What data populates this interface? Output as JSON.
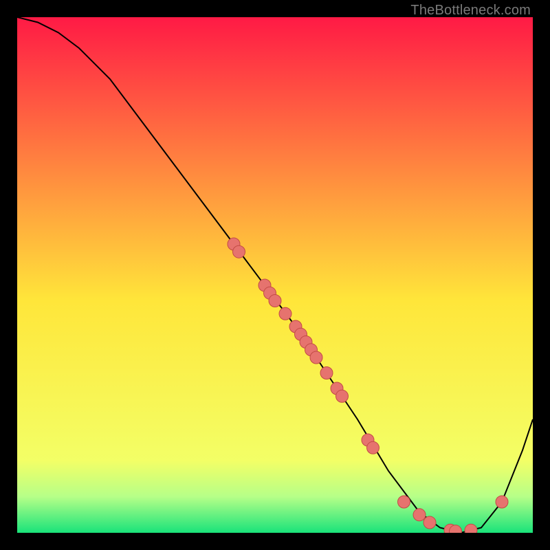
{
  "attribution": "TheBottleneck.com",
  "chart_data": {
    "type": "line",
    "title": "",
    "xlabel": "",
    "ylabel": "",
    "xlim": [
      0,
      100
    ],
    "ylim": [
      0,
      100
    ],
    "background_gradient": {
      "top_color": "#ff1a45",
      "mid_color": "#ffe63a",
      "bottom_color": "#19e37a"
    },
    "series": [
      {
        "name": "bottleneck-curve",
        "x": [
          0,
          4,
          8,
          12,
          18,
          24,
          30,
          36,
          42,
          48,
          54,
          58,
          62,
          66,
          72,
          78,
          82,
          86,
          90,
          94,
          98,
          100
        ],
        "y": [
          100,
          99,
          97,
          94,
          88,
          80,
          72,
          64,
          56,
          48,
          40,
          34,
          28,
          22,
          12,
          4,
          1,
          0,
          1,
          6,
          16,
          22
        ],
        "stroke": "#000000",
        "stroke_width": 2
      }
    ],
    "points": {
      "name": "highlighted-points",
      "fill": "#e6736e",
      "stroke": "#c24b45",
      "radius": 9,
      "coords": [
        {
          "x": 42,
          "y": 56
        },
        {
          "x": 43,
          "y": 54.5
        },
        {
          "x": 48,
          "y": 48
        },
        {
          "x": 49,
          "y": 46.5
        },
        {
          "x": 50,
          "y": 45
        },
        {
          "x": 52,
          "y": 42.5
        },
        {
          "x": 54,
          "y": 40
        },
        {
          "x": 55,
          "y": 38.5
        },
        {
          "x": 56,
          "y": 37
        },
        {
          "x": 57,
          "y": 35.5
        },
        {
          "x": 58,
          "y": 34
        },
        {
          "x": 60,
          "y": 31
        },
        {
          "x": 62,
          "y": 28
        },
        {
          "x": 63,
          "y": 26.5
        },
        {
          "x": 68,
          "y": 18
        },
        {
          "x": 69,
          "y": 16.5
        },
        {
          "x": 75,
          "y": 6
        },
        {
          "x": 78,
          "y": 3.5
        },
        {
          "x": 80,
          "y": 2
        },
        {
          "x": 84,
          "y": 0.5
        },
        {
          "x": 85,
          "y": 0.3
        },
        {
          "x": 88,
          "y": 0.5
        },
        {
          "x": 94,
          "y": 6
        }
      ]
    }
  }
}
